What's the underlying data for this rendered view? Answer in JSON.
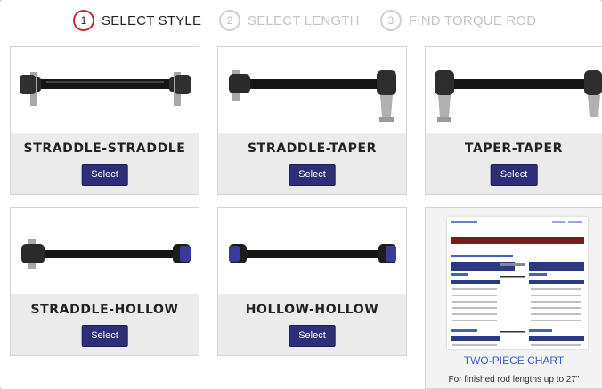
{
  "steps": [
    {
      "number": "1",
      "label": "SELECT STYLE",
      "state": "active"
    },
    {
      "number": "2",
      "label": "SELECT LENGTH",
      "state": "inactive"
    },
    {
      "number": "3",
      "label": "FIND TORQUE ROD",
      "state": "inactive"
    }
  ],
  "products": [
    {
      "title": "STRADDLE-STRADDLE",
      "button": "Select"
    },
    {
      "title": "STRADDLE-TAPER",
      "button": "Select"
    },
    {
      "title": "TAPER-TAPER",
      "button": "Select"
    },
    {
      "title": "STRADDLE-HOLLOW",
      "button": "Select"
    },
    {
      "title": "HOLLOW-HOLLOW",
      "button": "Select"
    }
  ],
  "chart_card": {
    "link": "TWO-PIECE CHART",
    "description": "For finished rod lengths up to 27\""
  },
  "colors": {
    "accent_red": "#c62828",
    "button_navy": "#2e2d7a",
    "link_blue": "#3b62c9",
    "bushing_blue": "#3a3a9a"
  }
}
